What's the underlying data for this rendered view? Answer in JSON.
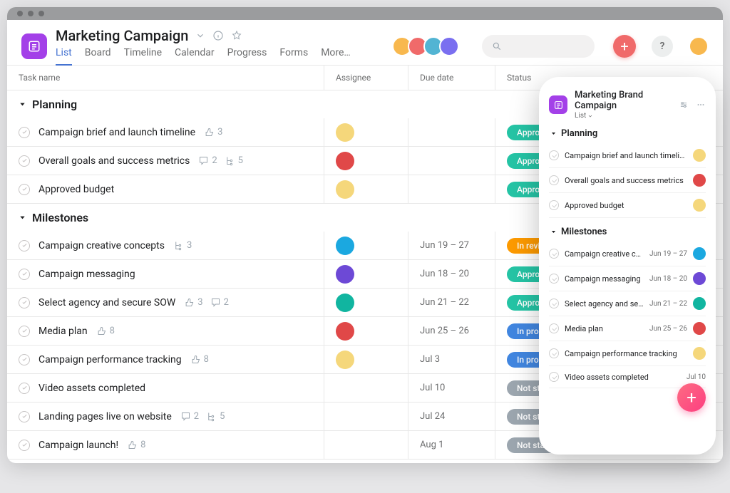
{
  "project": {
    "title": "Marketing Campaign"
  },
  "tabs": [
    "List",
    "Board",
    "Timeline",
    "Calendar",
    "Progress",
    "Forms",
    "More…"
  ],
  "activeTab": "List",
  "columns": {
    "name": "Task name",
    "assignee": "Assignee",
    "due": "Due date",
    "status": "Status"
  },
  "avatarColors": [
    "#f8b84e",
    "#f06a6a",
    "#52b4d3",
    "#7a6ff0"
  ],
  "meAvatar": "#f8b84e",
  "sections": [
    {
      "title": "Planning",
      "tasks": [
        {
          "name": "Campaign brief and launch timeline",
          "likes": 3,
          "comments": null,
          "subtasks": null,
          "assignee": "#f5d77b",
          "due": "",
          "status": {
            "label": "Approved",
            "color": "green"
          }
        },
        {
          "name": "Overall goals and success metrics",
          "likes": null,
          "comments": 2,
          "subtasks": 5,
          "assignee": "#e04848",
          "due": "",
          "status": {
            "label": "Approved",
            "color": "green"
          }
        },
        {
          "name": "Approved budget",
          "likes": null,
          "comments": null,
          "subtasks": null,
          "assignee": "#f5d77b",
          "due": "",
          "status": {
            "label": "Approved",
            "color": "green"
          }
        }
      ]
    },
    {
      "title": "Milestones",
      "tasks": [
        {
          "name": "Campaign creative concepts",
          "likes": null,
          "comments": null,
          "subtasks": 3,
          "assignee": "#1ba8e0",
          "due": "Jun 19 – 27",
          "status": {
            "label": "In review",
            "color": "orange"
          }
        },
        {
          "name": "Campaign messaging",
          "likes": null,
          "comments": null,
          "subtasks": null,
          "assignee": "#6d49d6",
          "due": "Jun 18 – 20",
          "status": {
            "label": "Approved",
            "color": "green"
          }
        },
        {
          "name": "Select agency and secure SOW",
          "likes": 3,
          "comments": 2,
          "subtasks": null,
          "assignee": "#11b5a0",
          "due": "Jun 21 – 22",
          "status": {
            "label": "Approved",
            "color": "green"
          }
        },
        {
          "name": "Media plan",
          "likes": 8,
          "comments": null,
          "subtasks": null,
          "assignee": "#e04848",
          "due": "Jun 25 – 26",
          "status": {
            "label": "In progress",
            "color": "blue"
          }
        },
        {
          "name": "Campaign performance tracking",
          "likes": 8,
          "comments": null,
          "subtasks": null,
          "assignee": "#f5d77b",
          "due": "Jul 3",
          "status": {
            "label": "In progress",
            "color": "blue"
          }
        },
        {
          "name": "Video assets completed",
          "likes": null,
          "comments": null,
          "subtasks": null,
          "assignee": null,
          "due": "Jul 10",
          "status": {
            "label": "Not started",
            "color": "gray"
          }
        },
        {
          "name": "Landing pages live on website",
          "likes": null,
          "comments": 2,
          "subtasks": 5,
          "assignee": null,
          "due": "Jul 24",
          "status": {
            "label": "Not started",
            "color": "gray"
          }
        },
        {
          "name": "Campaign launch!",
          "likes": 8,
          "comments": null,
          "subtasks": null,
          "assignee": null,
          "due": "Aug 1",
          "status": {
            "label": "Not started",
            "color": "gray"
          }
        }
      ]
    }
  ],
  "mobile": {
    "title": "Marketing Brand Campaign",
    "view": "List",
    "sections": [
      {
        "title": "Planning",
        "tasks": [
          {
            "name": "Campaign brief and launch timeline",
            "due": "",
            "av": "#f5d77b"
          },
          {
            "name": "Overall goals and success metrics",
            "due": "",
            "av": "#e04848"
          },
          {
            "name": "Approved budget",
            "due": "",
            "av": "#f5d77b"
          }
        ]
      },
      {
        "title": "Milestones",
        "tasks": [
          {
            "name": "Campaign creative concepts",
            "due": "Jun 19 – 27",
            "av": "#1ba8e0"
          },
          {
            "name": "Campaign messaging",
            "due": "Jun 18 – 20",
            "av": "#6d49d6"
          },
          {
            "name": "Select agency and secure SOW",
            "due": "Jun 21 – 22",
            "av": "#11b5a0"
          },
          {
            "name": "Media plan",
            "due": "Jun 25 – 26",
            "av": "#e04848"
          },
          {
            "name": "Campaign performance tracking",
            "due": "",
            "av": "#f5d77b"
          },
          {
            "name": "Video assets completed",
            "due": "Jul 10",
            "av": null
          }
        ]
      }
    ]
  }
}
